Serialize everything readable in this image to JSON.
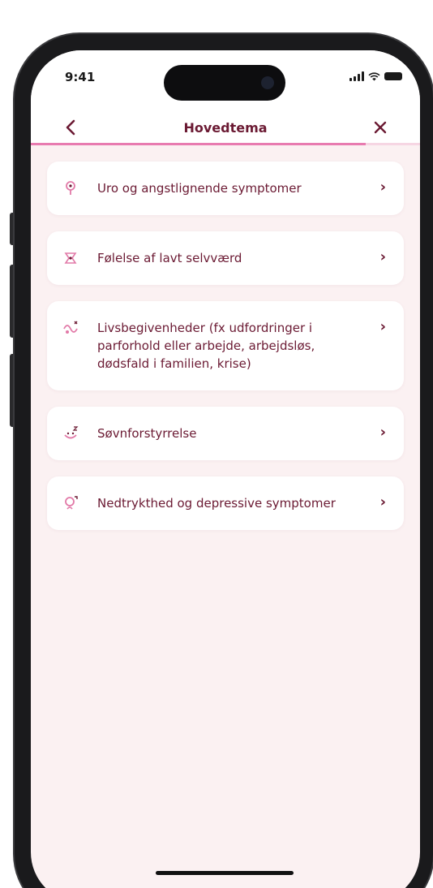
{
  "status_bar": {
    "time": "9:41"
  },
  "header": {
    "title": "Hovedtema",
    "progress_percent": 86
  },
  "topics": [
    {
      "label": "Uro og angstlignende symptomer",
      "icon": "anxiety-icon"
    },
    {
      "label": "Følelse af lavt selvværd",
      "icon": "low-self-esteem-icon"
    },
    {
      "label": "Livsbegivenheder (fx udfordringer i parforhold eller arbejde, arbejdsløs, dødsfald i familien, krise)",
      "icon": "life-events-icon"
    },
    {
      "label": "Søvnforstyrrelse",
      "icon": "sleep-icon"
    },
    {
      "label": "Nedtrykthed og depressive symptomer",
      "icon": "depression-icon"
    }
  ],
  "colors": {
    "accent": "#6b1a33",
    "progress": "#e87bb0",
    "background": "#fbf1f2",
    "icon_pink": "#e27aa8"
  }
}
